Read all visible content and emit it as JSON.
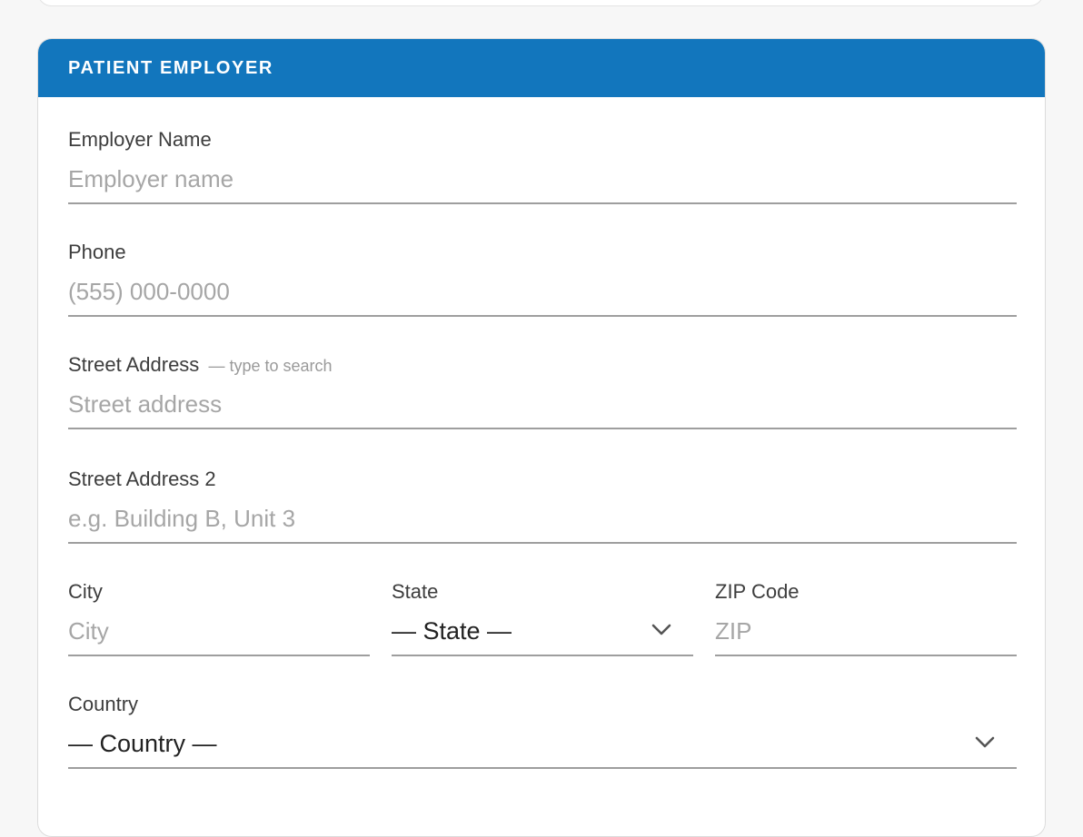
{
  "section": {
    "title": "PATIENT EMPLOYER"
  },
  "fields": {
    "employer_name": {
      "label": "Employer Name",
      "placeholder": "Employer name",
      "value": ""
    },
    "phone": {
      "label": "Phone",
      "placeholder": "(555) 000-0000",
      "value": ""
    },
    "street_address": {
      "label": "Street Address",
      "hint": "— type to search",
      "placeholder": "Street address",
      "value": ""
    },
    "street_address_2": {
      "label": "Street Address 2",
      "placeholder": "e.g. Building B, Unit 3",
      "value": ""
    },
    "city": {
      "label": "City",
      "placeholder": "City",
      "value": ""
    },
    "state": {
      "label": "State",
      "selected": "— State —"
    },
    "zip": {
      "label": "ZIP Code",
      "placeholder": "ZIP",
      "value": ""
    },
    "country": {
      "label": "Country",
      "selected": "— Country —"
    }
  },
  "icons": {
    "dropdown": "chevron-down-icon"
  },
  "colors": {
    "header_bg": "#1276bd",
    "header_text": "#ffffff",
    "page_bg": "#f7f7f7",
    "underline": "#9e9e9e",
    "placeholder": "#a6a6a6"
  }
}
